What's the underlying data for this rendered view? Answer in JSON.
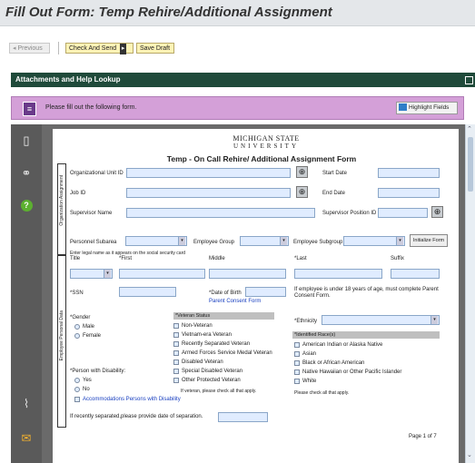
{
  "title": "Fill Out Form: Temp Rehire/Additional Assignment",
  "toolbar": {
    "previous": "Previous",
    "check_and_send": "Check And Send",
    "save_draft": "Save Draft"
  },
  "section": {
    "label": "Attachments and Help Lookup"
  },
  "instruction": {
    "text": "Please fill out the following form.",
    "highlight": "Highlight Fields"
  },
  "form": {
    "logo_line1": "MICHIGAN STATE",
    "logo_line2": "UNIVERSITY",
    "heading": "Temp - On Call Rehire/ Additional Assignment Form",
    "side_org": "Organization Assignment",
    "side_emp": "Employee Personal Data",
    "org_unit": "Organizational Unit ID",
    "start_date": "Start Date",
    "job_id": "Job ID",
    "end_date": "End Date",
    "supervisor_name": "Supervisor Name",
    "supervisor_pos": "Supervisor Position ID",
    "personnel_subarea": "Personnel Subarea",
    "employee_group": "Employee Group",
    "employee_subgroup": "Employee Subgroup",
    "initialize": "Initialize Form",
    "legal_name_note": "Enter legal name as it appears on the social security card",
    "name_title": "Title",
    "name_first": "*First",
    "name_middle": "Middle",
    "name_last": "*Last",
    "name_suffix": "Suffix",
    "ssn": "*SSN",
    "dob": "*Date of Birth",
    "parent_consent_link": "Parent Consent Form",
    "under18": "If employee is under 18 years of age, must complete Parent Consent Form.",
    "gender": "*Gender",
    "male": "Male",
    "female": "Female",
    "veteran_status": "*Veteran Status",
    "veteran_opts": [
      "Non-Veteran",
      "Vietnam-era Veteran",
      "Recently Separated Veteran",
      "Armed Forces Service Medal Veteran",
      "Disabled Veteran",
      "Special Disabled Veteran",
      "Other Protected Veteran"
    ],
    "veteran_note": "If veteran, please check all that apply.",
    "ethnicity": "*Ethnicity",
    "race_header": "*Identified Race(s)",
    "race_opts": [
      "American Indian or Alaska Native",
      "Asian",
      "Black or African American",
      "Native Hawaiian or Other Pacific Islander",
      "White"
    ],
    "race_note": "Please check all that apply.",
    "disability": "*Person with Disability:",
    "yes": "Yes",
    "no": "No",
    "accommodations": "Accommodations Persons with Disability",
    "separation": "If recently separated,please provide date of separation.",
    "page_num": "Page  1 of 7"
  },
  "colors": {
    "accent_bar": "#1f4a3a",
    "pink_bar": "#d4a0d8",
    "field_fill": "#e0ecff"
  }
}
